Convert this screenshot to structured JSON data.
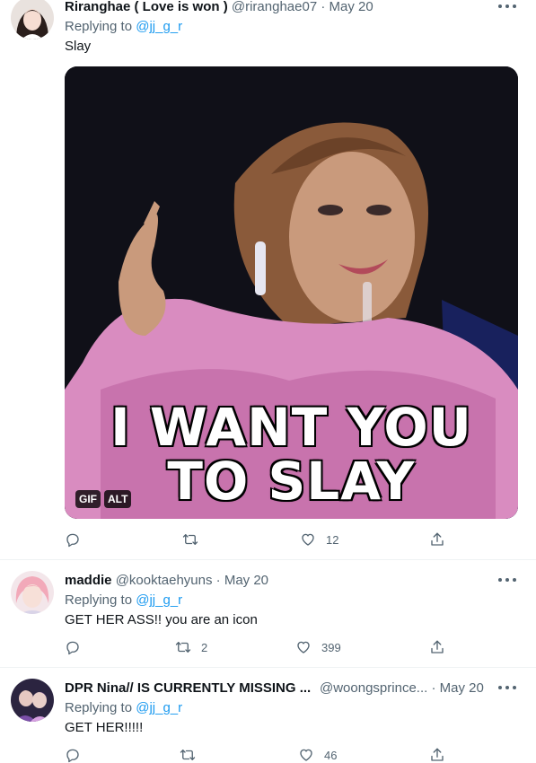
{
  "tweets": [
    {
      "name": "Riranghae ( Love is won )",
      "handle": "@riranghae07",
      "separator": "·",
      "date": "May 20",
      "replying_prefix": "Replying to",
      "replying_to": "@jj_g_r",
      "text": "Slay",
      "gif": {
        "caption_line1": "I WANT YOU",
        "caption_line2": "TO SLAY",
        "gif_badge": "GIF",
        "alt_badge": "ALT"
      },
      "actions": {
        "reply": "",
        "retweet": "",
        "like": "12"
      }
    },
    {
      "name": "maddie",
      "handle": "@kooktaehyuns",
      "separator": "·",
      "date": "May 20",
      "replying_prefix": "Replying to",
      "replying_to": "@jj_g_r",
      "text": "GET HER ASS!! you are an icon",
      "actions": {
        "reply": "",
        "retweet": "2",
        "like": "399"
      }
    },
    {
      "name": "DPR Nina// IS CURRENTLY MISSING ...",
      "handle": "@woongsprince...",
      "separator": "·",
      "date": "May 20",
      "replying_prefix": "Replying to",
      "replying_to": "@jj_g_r",
      "text": "GET HER!!!!!",
      "actions": {
        "reply": "",
        "retweet": "",
        "like": "46"
      }
    }
  ],
  "icons": {
    "reply": "reply-icon",
    "retweet": "retweet-icon",
    "like": "heart-icon",
    "share": "share-icon",
    "more": "more-icon"
  },
  "colors": {
    "link": "#1d9bf0",
    "secondary_text": "#536471",
    "primary_text": "#0f1419",
    "divider": "#eff3f4"
  }
}
